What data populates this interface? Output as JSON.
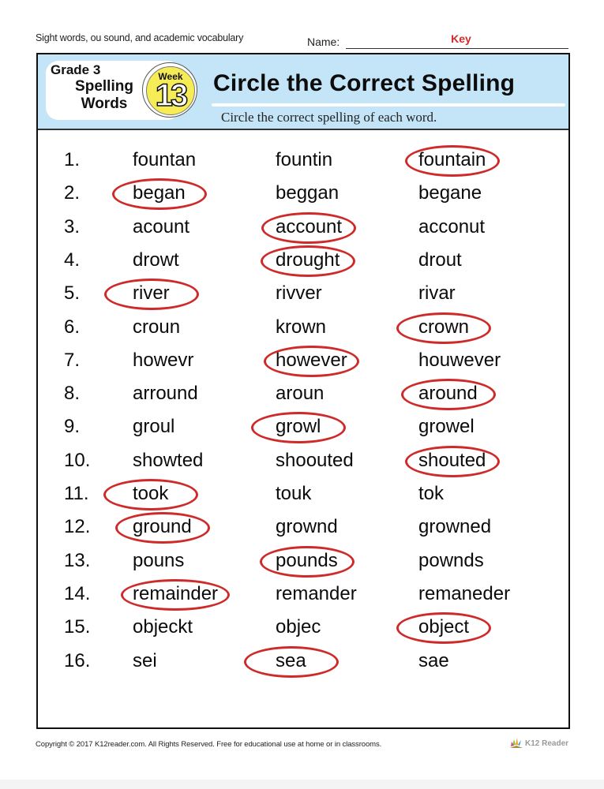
{
  "header": {
    "subtitle": "Sight words, ou sound, and academic vocabulary",
    "name_label": "Name:",
    "name_value": "Key"
  },
  "banner": {
    "grade": "Grade 3",
    "spelling_line1": "Spelling",
    "spelling_line2": "Words",
    "week_label": "Week",
    "week_number": "13",
    "title": "Circle the Correct Spelling",
    "instruction": "Circle the correct spelling of each word."
  },
  "colors": {
    "banner_bg": "#c4e4f7",
    "badge_yellow": "#f5ec56",
    "circle_red": "#cf2a2a",
    "key_red": "#d32b2b"
  },
  "questions": [
    {
      "number": "1.",
      "options": [
        "fountan",
        "fountin",
        "fountain"
      ],
      "correct_index": 2
    },
    {
      "number": "2.",
      "options": [
        "began",
        "beggan",
        "begane"
      ],
      "correct_index": 0
    },
    {
      "number": "3.",
      "options": [
        "acount",
        "account",
        "acconut"
      ],
      "correct_index": 1
    },
    {
      "number": "4.",
      "options": [
        "drowt",
        "drought",
        "drout"
      ],
      "correct_index": 1
    },
    {
      "number": "5.",
      "options": [
        "river",
        "rivver",
        "rivar"
      ],
      "correct_index": 0
    },
    {
      "number": "6.",
      "options": [
        "croun",
        "krown",
        "crown"
      ],
      "correct_index": 2
    },
    {
      "number": "7.",
      "options": [
        "howevr",
        "however",
        "houwever"
      ],
      "correct_index": 1
    },
    {
      "number": "8.",
      "options": [
        "arround",
        "aroun",
        "around"
      ],
      "correct_index": 2
    },
    {
      "number": "9.",
      "options": [
        "groul",
        "growl",
        "growel"
      ],
      "correct_index": 1
    },
    {
      "number": "10.",
      "options": [
        "showted",
        "shoouted",
        "shouted"
      ],
      "correct_index": 2
    },
    {
      "number": "11.",
      "options": [
        "took",
        "touk",
        "tok"
      ],
      "correct_index": 0
    },
    {
      "number": "12.",
      "options": [
        "ground",
        "grownd",
        "growned"
      ],
      "correct_index": 0
    },
    {
      "number": "13.",
      "options": [
        "pouns",
        "pounds",
        "pownds"
      ],
      "correct_index": 1
    },
    {
      "number": "14.",
      "options": [
        "remainder",
        "remander",
        "remaneder"
      ],
      "correct_index": 0
    },
    {
      "number": "15.",
      "options": [
        "objeckt",
        "objec",
        "object"
      ],
      "correct_index": 2
    },
    {
      "number": "16.",
      "options": [
        "sei",
        "sea",
        "sae"
      ],
      "correct_index": 1
    }
  ],
  "footer": {
    "copyright": "Copyright © 2017  K12reader.com. All Rights Reserved. Free for educational use at home or in classrooms.",
    "logo_text": "K12 Reader",
    "logo_icon": "book-leaves-icon"
  }
}
